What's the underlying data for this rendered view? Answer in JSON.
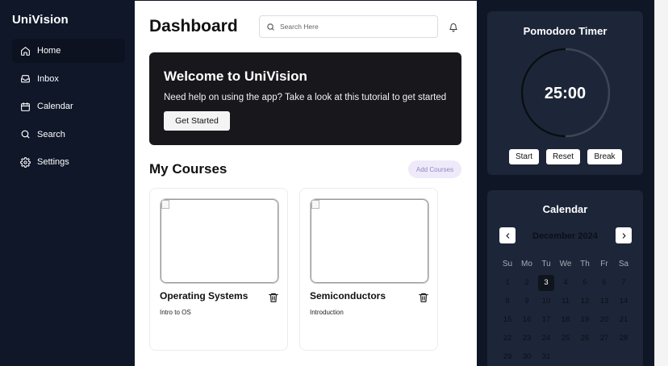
{
  "sidebar": {
    "brand": "UniVision",
    "items": [
      {
        "label": "Home",
        "icon": "home-icon",
        "active": true
      },
      {
        "label": "Inbox",
        "icon": "inbox-icon"
      },
      {
        "label": "Calendar",
        "icon": "calendar-icon"
      },
      {
        "label": "Search",
        "icon": "search-icon"
      },
      {
        "label": "Settings",
        "icon": "gear-icon"
      }
    ]
  },
  "main": {
    "title": "Dashboard",
    "search": {
      "placeholder": "Search Here",
      "value": ""
    },
    "welcome": {
      "title": "Welcome to UniVision",
      "text": "Need help on using the app? Take a look at this tutorial to get started",
      "button": "Get Started"
    },
    "courses": {
      "title": "My Courses",
      "add_button": "Add Courses",
      "items": [
        {
          "name": "Operating Systems",
          "subtitle": "Intro to OS"
        },
        {
          "name": "Semiconductors",
          "subtitle": "Introduction"
        }
      ]
    }
  },
  "pomodoro": {
    "title": "Pomodoro Timer",
    "time": "25:00",
    "progress": 0.5,
    "buttons": [
      "Start",
      "Reset",
      "Break"
    ]
  },
  "calendar": {
    "title": "Calendar",
    "month": "December 2024",
    "weekdays": [
      "Su",
      "Mo",
      "Tu",
      "We",
      "Th",
      "Fr",
      "Sa"
    ],
    "today": 3,
    "weeks": [
      [
        "1",
        "2",
        "3",
        "4",
        "5",
        "6",
        "7"
      ],
      [
        "8",
        "9",
        "10",
        "11",
        "12",
        "13",
        "14"
      ],
      [
        "15",
        "16",
        "17",
        "18",
        "19",
        "20",
        "21"
      ],
      [
        "22",
        "23",
        "24",
        "25",
        "26",
        "27",
        "28"
      ],
      [
        "29",
        "30",
        "31",
        "",
        "",
        "",
        ""
      ]
    ]
  },
  "colors": {
    "sidebar_bg": "#0f1729",
    "panel_bg": "#1d2638",
    "banner_bg": "#17171c",
    "accent_soft": "#eeeaf9",
    "accent_text": "#8f86c9"
  }
}
